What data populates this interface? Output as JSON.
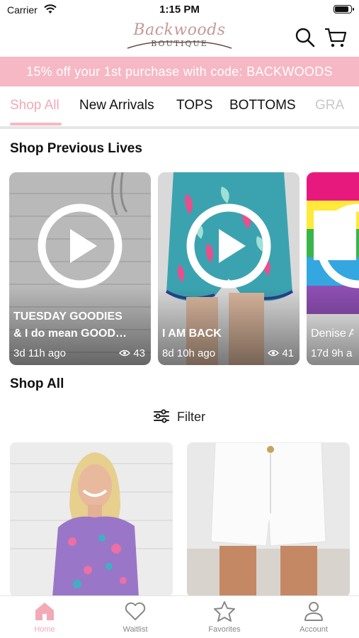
{
  "status_bar": {
    "carrier": "Carrier",
    "time": "1:15 PM"
  },
  "header": {
    "logo_script": "Backwoods",
    "logo_sub": "BOUTIQUE",
    "icons": [
      "search-icon",
      "cart-icon"
    ]
  },
  "promo": {
    "text": "15% off your 1st purchase with code: BACKWOODS"
  },
  "tabs": [
    {
      "label": "Shop All",
      "active": true
    },
    {
      "label": "New Arrivals"
    },
    {
      "label": "TOPS"
    },
    {
      "label": "BOTTOMS"
    },
    {
      "label": "GRA"
    }
  ],
  "previous_lives": {
    "title": "Shop Previous Lives",
    "cards": [
      {
        "title_line1": "TUESDAY GOODIES",
        "title_line2": "& I do mean GOOD…",
        "age": "3d 11h ago",
        "views": "43"
      },
      {
        "title_line1": "I AM BACK",
        "age": "8d 10h ago",
        "views": "41"
      },
      {
        "title_line1": "Denise A",
        "age": "17d 9h a"
      }
    ]
  },
  "shop_all": {
    "title": "Shop All",
    "filter_label": "Filter"
  },
  "bottom_nav": [
    {
      "label": "Home",
      "icon": "home-icon",
      "active": true
    },
    {
      "label": "Waitlist",
      "icon": "heart-icon"
    },
    {
      "label": "Favorites",
      "icon": "star-icon"
    },
    {
      "label": "Account",
      "icon": "person-icon"
    }
  ],
  "colors": {
    "accent": "#f3a9b6",
    "promo_bg": "#f6b8c4",
    "logo": "#c49a9a"
  }
}
